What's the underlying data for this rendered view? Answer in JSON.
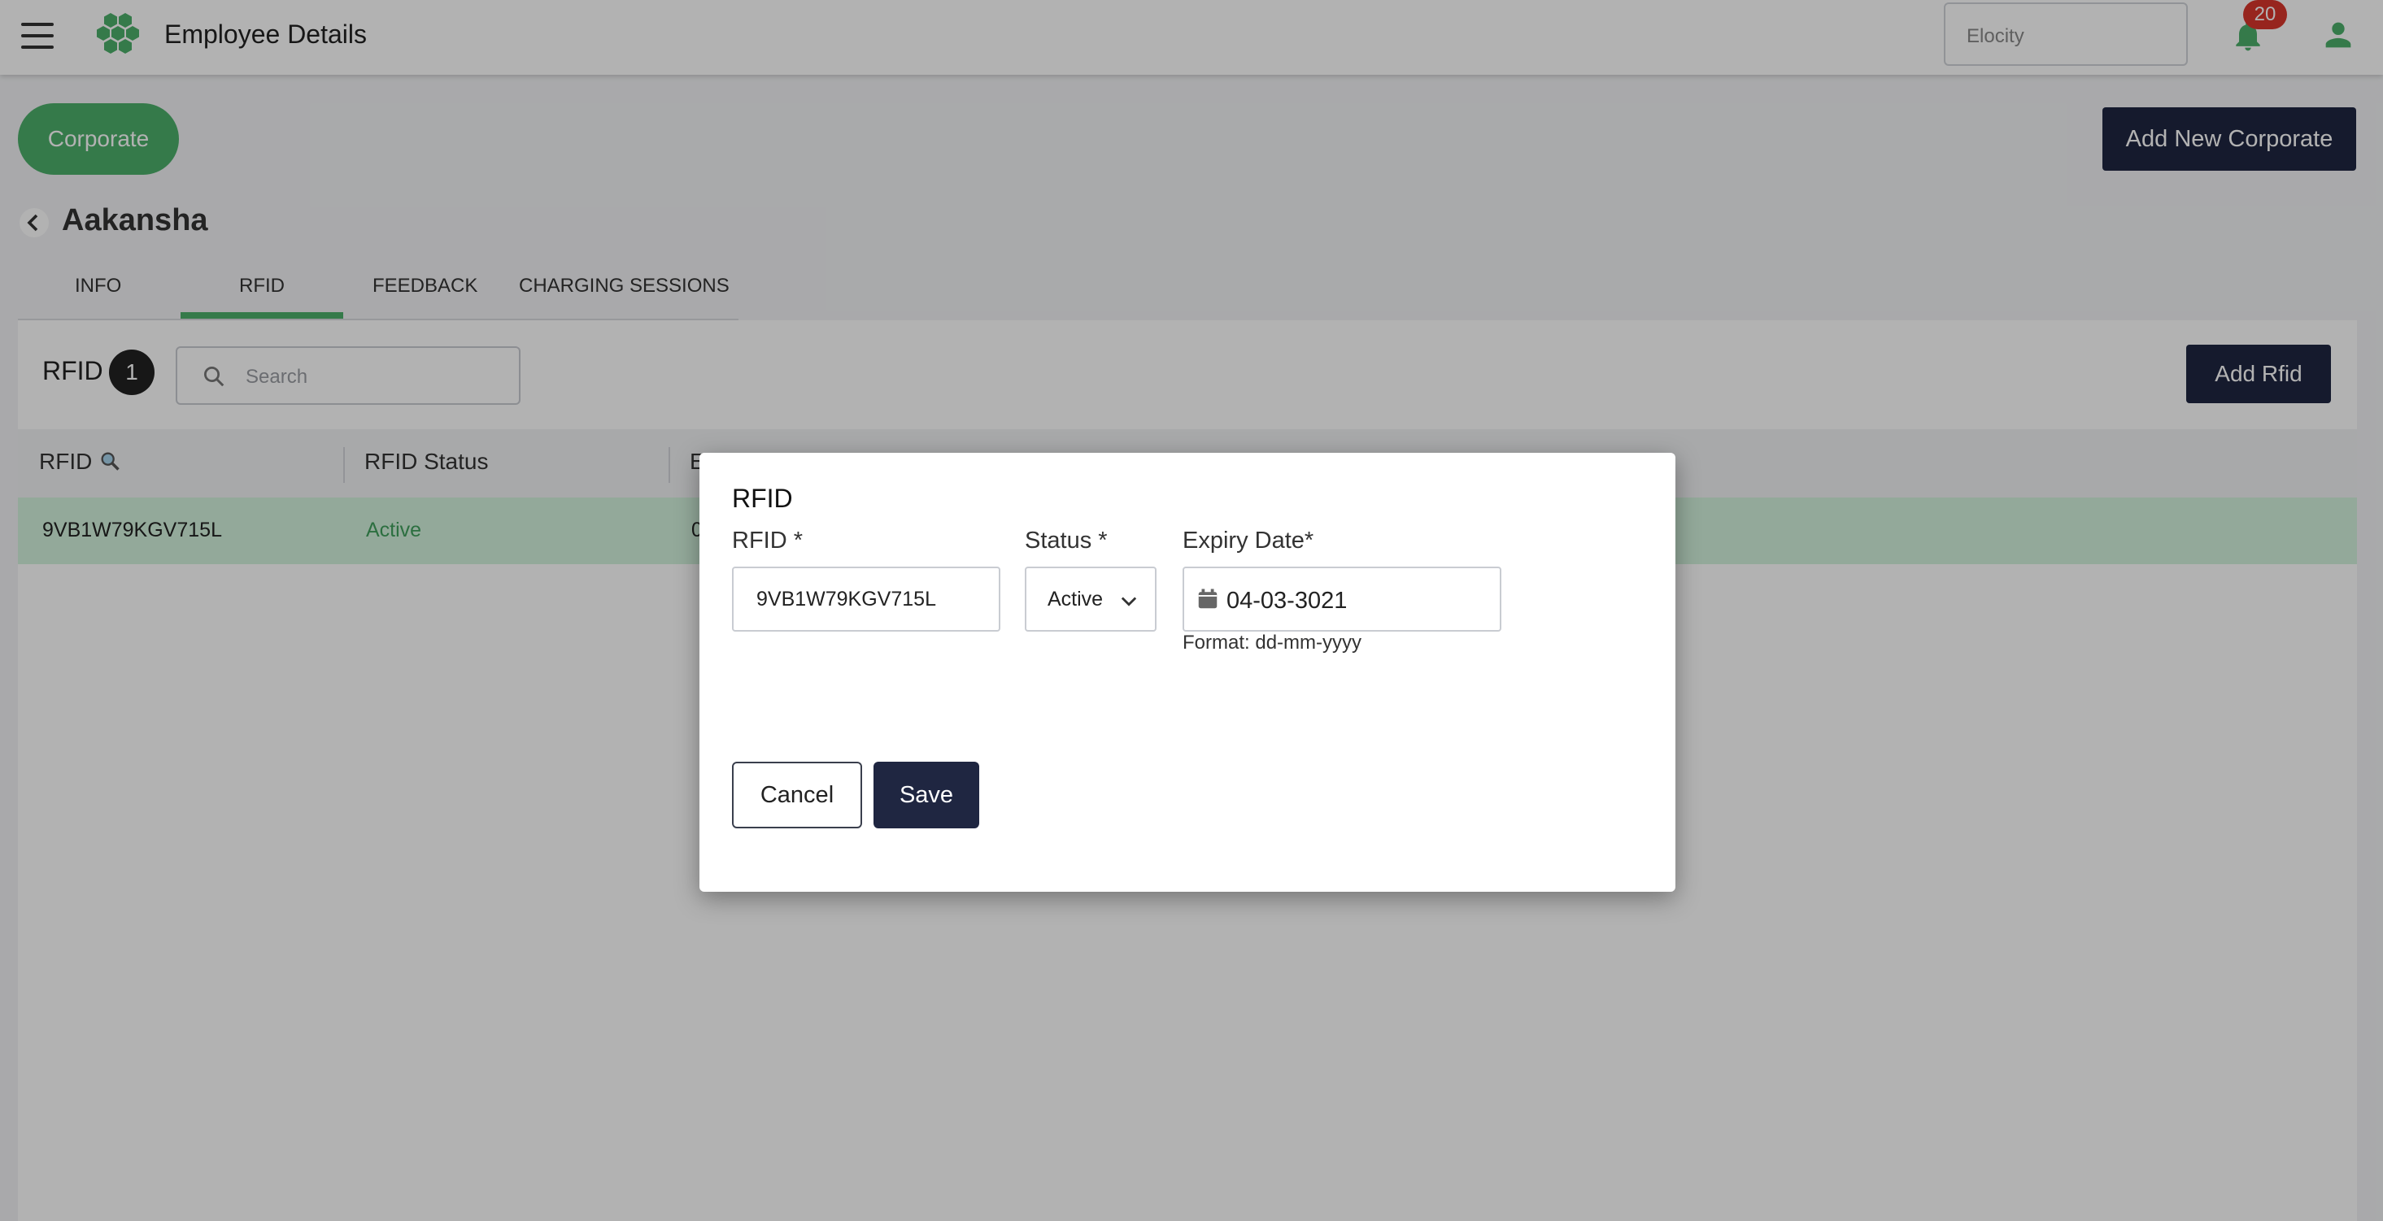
{
  "header": {
    "title": "Employee Details",
    "org_select_value": "Elocity",
    "notification_count": "20"
  },
  "page": {
    "corporate_label": "Corporate",
    "add_corporate_label": "Add New Corporate",
    "employee_name": "Aakansha"
  },
  "tabs": [
    {
      "label": "INFO"
    },
    {
      "label": "RFID"
    },
    {
      "label": "FEEDBACK"
    },
    {
      "label": "CHARGING SESSIONS"
    }
  ],
  "active_tab": "RFID",
  "rfid_panel": {
    "heading": "RFID",
    "count": "1",
    "search_placeholder": "Search",
    "add_button": "Add Rfid",
    "columns": [
      {
        "label": "RFID"
      },
      {
        "label": "RFID Status"
      },
      {
        "label": "E"
      }
    ],
    "rows": [
      {
        "rfid": "9VB1W79KGV715L",
        "status": "Active",
        "third": "0"
      }
    ]
  },
  "dialog": {
    "title": "RFID",
    "rfid_label": "RFID *",
    "rfid_value": "9VB1W79KGV715L",
    "status_label": "Status *",
    "status_value": "Active",
    "expiry_label": "Expiry Date*",
    "expiry_value": "04-03-3021",
    "expiry_hint": "Format: dd-mm-yyyy",
    "cancel_label": "Cancel",
    "save_label": "Save"
  },
  "colors": {
    "accent_green": "#4caf6a",
    "primary_navy": "#1f2641",
    "badge_red": "#d9352b",
    "row_highlight": "#d3f2dd"
  }
}
